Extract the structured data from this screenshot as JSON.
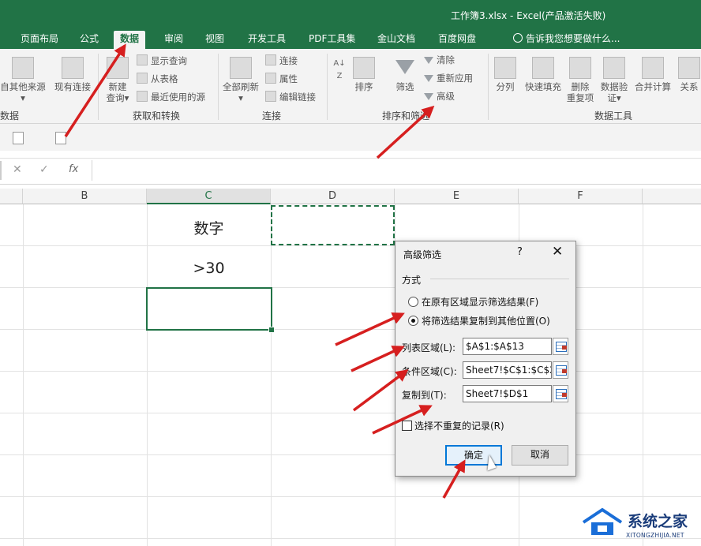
{
  "window": {
    "title": "工作簿3.xlsx - Excel(产品激活失败)"
  },
  "tabs": [
    {
      "label": "页面布局",
      "active": false
    },
    {
      "label": "公式",
      "active": false
    },
    {
      "label": "数据",
      "active": true
    },
    {
      "label": "审阅",
      "active": false
    },
    {
      "label": "视图",
      "active": false
    },
    {
      "label": "开发工具",
      "active": false
    },
    {
      "label": "PDF工具集",
      "active": false
    },
    {
      "label": "金山文档",
      "active": false
    },
    {
      "label": "百度网盘",
      "active": false
    }
  ],
  "tell_me": "告诉我您想要做什么...",
  "ribbon": {
    "get_external": {
      "from_other": "自其他来源",
      "existing": "现有连接",
      "group_label": "数据"
    },
    "get_transform": {
      "new_query_l1": "新建",
      "new_query_l2": "查询",
      "show_queries": "显示查询",
      "from_table": "从表格",
      "recent_sources": "最近使用的源",
      "group_label": "获取和转换"
    },
    "connections": {
      "refresh_all": "全部刷新",
      "connections": "连接",
      "properties": "属性",
      "edit_links": "编辑链接",
      "group_label": "连接"
    },
    "sort_filter": {
      "sort": "排序",
      "filter": "筛选",
      "clear": "清除",
      "reapply": "重新应用",
      "advanced": "高级",
      "group_label": "排序和筛选"
    },
    "data_tools": {
      "text_to_columns": "分列",
      "flash_fill": "快速填充",
      "remove_dup_l1": "删除",
      "remove_dup_l2": "重复项",
      "validation_l1": "数据验",
      "validation_l2": "证",
      "consolidate": "合并计算",
      "relationships": "关系",
      "group_label": "数据工具"
    }
  },
  "formula_bar": {
    "cancel": "✕",
    "enter": "✓",
    "fx": "fx",
    "value": ""
  },
  "sheet": {
    "columns": [
      "B",
      "C",
      "D",
      "E",
      "F"
    ],
    "selected_column": "C",
    "cells": {
      "C1": "数字",
      "C2": ">30"
    }
  },
  "dialog": {
    "title": "高级筛选",
    "help": "?",
    "close": "✕",
    "method_label": "方式",
    "option_in_place": "在原有区域显示筛选结果(F)",
    "option_copy": "将筛选结果复制到其他位置(O)",
    "selected_option": "copy",
    "list_range_label": "列表区域(L):",
    "list_range_value": "$A$1:$A$13",
    "criteria_range_label": "条件区域(C):",
    "criteria_range_value": "Sheet7!$C$1:$C$2",
    "copy_to_label": "复制到(T):",
    "copy_to_value": "Sheet7!$D$1",
    "unique_label": "选择不重复的记录(R)",
    "unique_checked": false,
    "ok": "确定",
    "cancel": "取消"
  },
  "watermark": {
    "cn": "系统之家",
    "en": "XITONGZHIJIA.NET"
  },
  "colors": {
    "excel_green": "#217346",
    "arrow_red": "#d61f1f",
    "dialog_primary": "#0078d7"
  }
}
